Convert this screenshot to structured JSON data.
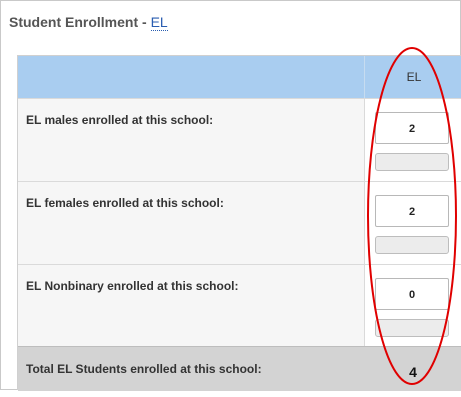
{
  "section": {
    "title_prefix": "Student Enrollment - ",
    "title_link": "EL"
  },
  "table": {
    "column_header": "EL",
    "rows": [
      {
        "label": "EL males enrolled at this school:",
        "value": "2"
      },
      {
        "label": "EL females enrolled at this school:",
        "value": "2"
      },
      {
        "label": "EL Nonbinary enrolled at this school:",
        "value": "0"
      }
    ],
    "total": {
      "label": "Total EL Students enrolled at this school:",
      "value": "4"
    }
  },
  "colors": {
    "header_bg": "#a9cdf0",
    "total_bg": "#d3d3d3",
    "annotation_red": "#e00000",
    "link": "#2a5db0"
  }
}
